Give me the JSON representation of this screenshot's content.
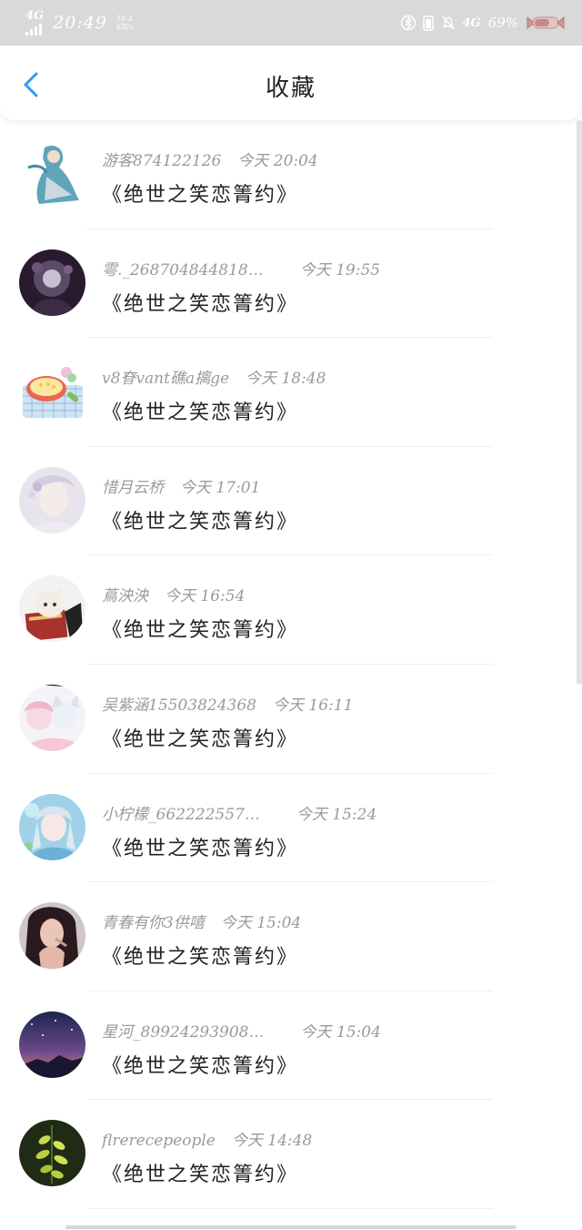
{
  "status_bar": {
    "network": "4G",
    "time": "20:49",
    "speed_value": "16.4",
    "speed_unit": "KB/s",
    "network_right": "4G",
    "battery_percent": "69%"
  },
  "header": {
    "title": "收藏",
    "accent_color": "#2f9bf4"
  },
  "items": [
    {
      "user": "游客874122126",
      "time": "今天 20:04",
      "title": "《绝世之笑恋箐约》"
    },
    {
      "user": "雩._268704844818…",
      "time": "今天 19:55",
      "title": "《绝世之笑恋箐约》"
    },
    {
      "user": "v8眘vant礁a摛ge",
      "time": "今天 18:48",
      "title": "《绝世之笑恋箐约》"
    },
    {
      "user": "惜月云桥",
      "time": "今天 17:01",
      "title": "《绝世之笑恋箐约》"
    },
    {
      "user": "蔦泱泱",
      "time": "今天 16:54",
      "title": "《绝世之笑恋箐约》"
    },
    {
      "user": "吴紫涵15503824368",
      "time": "今天 16:11",
      "title": "《绝世之笑恋箐约》"
    },
    {
      "user": "小柠檬_662222557…",
      "time": "今天 15:24",
      "title": "《绝世之笑恋箐约》"
    },
    {
      "user": "青春有你3供嘻",
      "time": "今天 15:04",
      "title": "《绝世之笑恋箐约》"
    },
    {
      "user": "星河_89924293908…",
      "time": "今天 15:04",
      "title": "《绝世之笑恋箐约》"
    },
    {
      "user": "flrerecepeople",
      "time": "今天 14:48",
      "title": "《绝世之笑恋箐约》"
    }
  ]
}
